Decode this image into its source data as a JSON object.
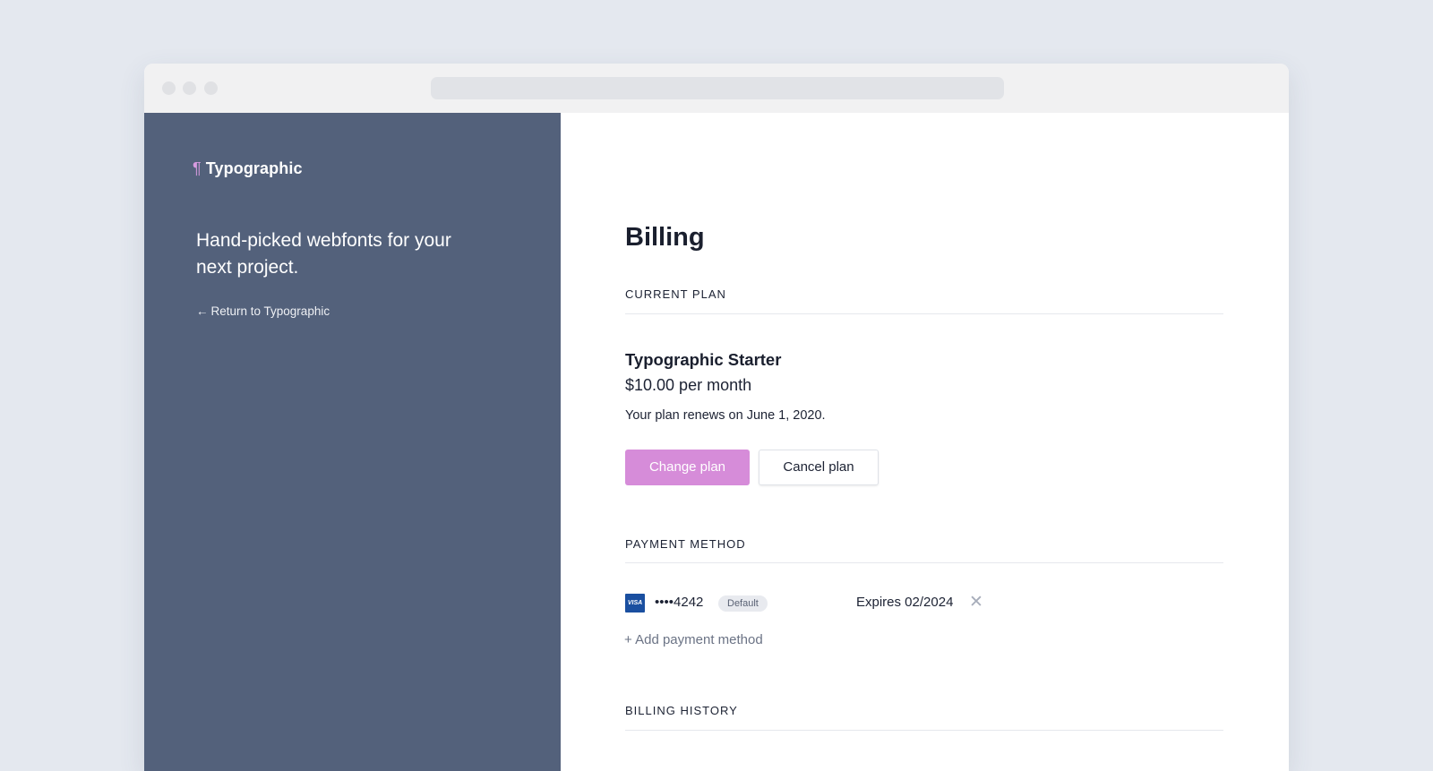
{
  "sidebar": {
    "brand_glyph": "¶",
    "brand_name": "Typographic",
    "tagline": "Hand-picked webfonts for your next project.",
    "return_arrow": "←",
    "return_label": "Return to Typographic"
  },
  "main": {
    "title": "Billing",
    "current_plan": {
      "label": "CURRENT PLAN",
      "name": "Typographic Starter",
      "price": "$10.00 per month",
      "renewal": "Your plan renews on June 1, 2020.",
      "change_label": "Change plan",
      "cancel_label": "Cancel plan"
    },
    "payment_method": {
      "label": "PAYMENT METHOD",
      "card_brand": "VISA",
      "card_number": "••••4242",
      "badge": "Default",
      "expires": "Expires 02/2024",
      "remove_glyph": "✕",
      "add_label": "+ Add payment method"
    },
    "billing_history": {
      "label": "BILLING HISTORY"
    }
  },
  "colors": {
    "sidebar_bg": "#53617b",
    "accent": "#d68cd9",
    "page_bg": "#e4e8ef"
  }
}
